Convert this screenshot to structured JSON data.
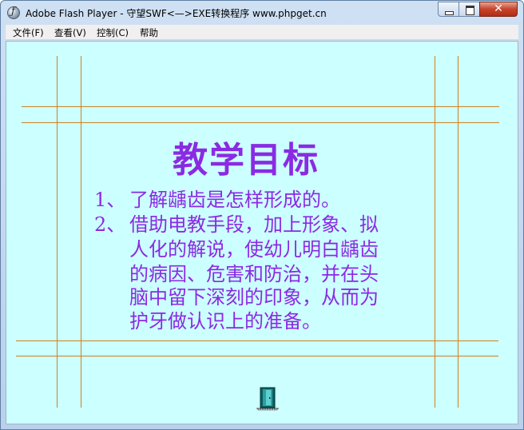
{
  "window": {
    "title": "Adobe Flash Player - 守望SWF<—>EXE转换程序 www.phpget.cn",
    "icon": "flash-player-icon",
    "controls": {
      "minimize": "minimize-icon",
      "maximize": "maximize-icon",
      "close": "✕"
    }
  },
  "menu": {
    "items": [
      {
        "label": "文件(F)"
      },
      {
        "label": "查看(V)"
      },
      {
        "label": "控制(C)"
      },
      {
        "label": "帮助"
      }
    ]
  },
  "stage": {
    "background": "#ccffff",
    "line_color": "#d08020",
    "text_color": "#8a2be2",
    "heading": "教学目标",
    "goals": [
      {
        "num": "1、",
        "lines": [
          "了解龋齿是怎样形成的。"
        ]
      },
      {
        "num": "2、",
        "lines": [
          "借助电教手段，加上形象、拟",
          "人化的解说，使幼儿明白龋齿",
          "的病因、危害和防治，并在头",
          "脑中留下深刻的印象，从而为",
          "护牙做认识上的准备。"
        ]
      }
    ],
    "nav_icon": "door-icon"
  }
}
